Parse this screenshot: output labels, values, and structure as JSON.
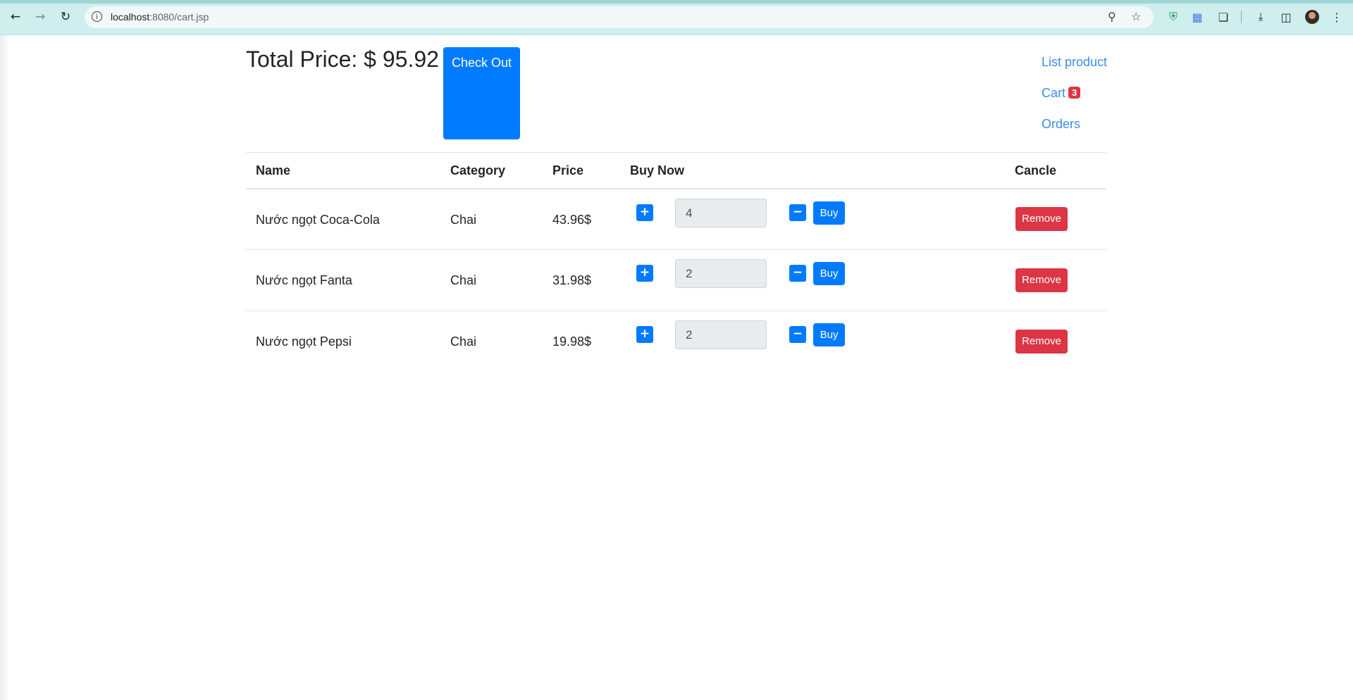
{
  "browser": {
    "url_host": "localhost",
    "url_path": ":8080/cart.jsp"
  },
  "colors": {
    "primary": "#007bff",
    "danger": "#dc3545",
    "link": "#3b8cf0",
    "chrome": "#cfeeee"
  },
  "header": {
    "total_price": "Total Price: $ 95.92",
    "checkout_label": "Check Out"
  },
  "nav": {
    "list_product": "List product",
    "cart": "Cart",
    "cart_count": "3",
    "orders": "Orders"
  },
  "table": {
    "columns": [
      "Name",
      "Category",
      "Price",
      "Buy Now",
      "Cancle"
    ],
    "rows": [
      {
        "name": "Nước ngọt Coca-Cola",
        "category": "Chai",
        "price": "43.96$",
        "quantity": "4",
        "buy_label": "Buy",
        "remove_label": "Remove"
      },
      {
        "name": "Nước ngọt Fanta",
        "category": "Chai",
        "price": "31.98$",
        "quantity": "2",
        "buy_label": "Buy",
        "remove_label": "Remove"
      },
      {
        "name": "Nước ngọt Pepsi",
        "category": "Chai",
        "price": "19.98$",
        "quantity": "2",
        "buy_label": "Buy",
        "remove_label": "Remove"
      }
    ]
  }
}
